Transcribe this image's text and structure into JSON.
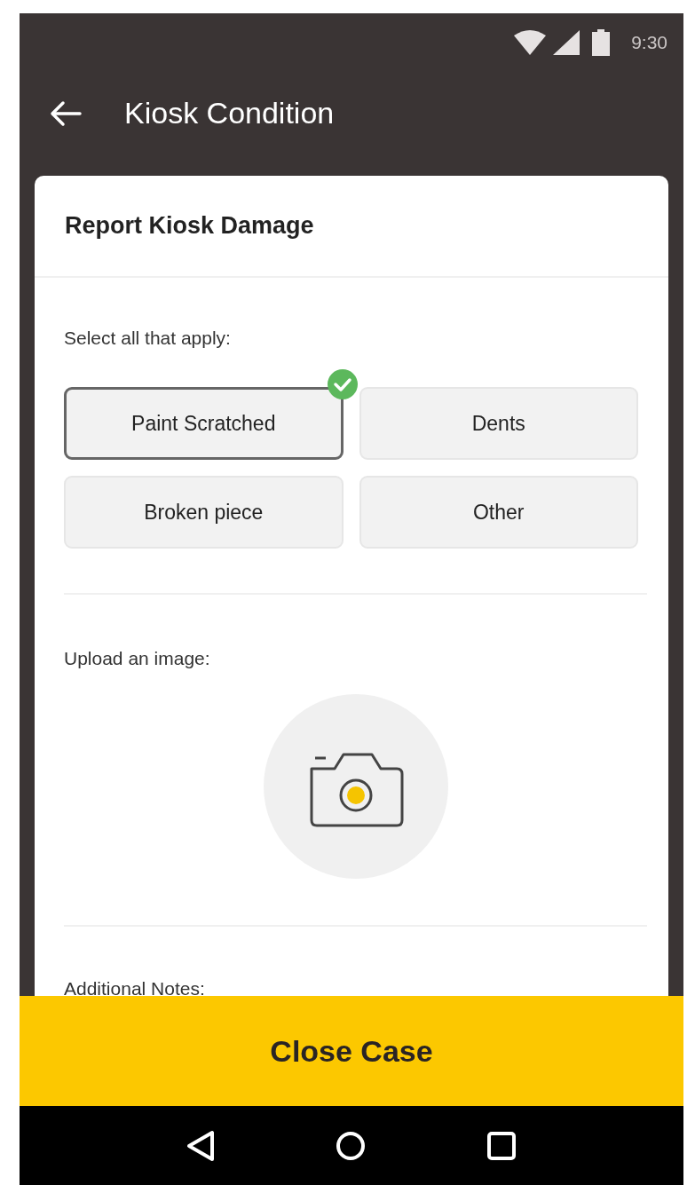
{
  "status_bar": {
    "time": "9:30"
  },
  "app_bar": {
    "title": "Kiosk Condition"
  },
  "card": {
    "title": "Report Kiosk Damage",
    "damage_prompt": "Select all that apply:",
    "options": [
      {
        "label": "Paint Scratched",
        "selected": true
      },
      {
        "label": "Dents",
        "selected": false
      },
      {
        "label": "Broken piece",
        "selected": false
      },
      {
        "label": "Other",
        "selected": false
      }
    ],
    "upload_label": "Upload an image:",
    "notes_label": "Additional Notes:"
  },
  "primary_button": "Close Case"
}
